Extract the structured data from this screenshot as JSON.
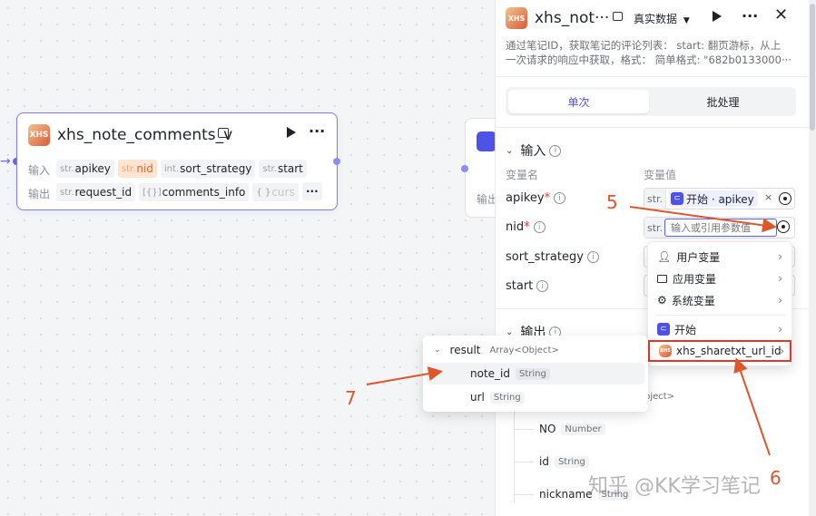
{
  "node": {
    "title": "xhs_note_comments_v",
    "input_label": "输入",
    "output_label": "输出",
    "inputs": [
      {
        "type": "str.",
        "name": "apikey",
        "highlight": false
      },
      {
        "type": "str.",
        "name": "nid",
        "highlight": true
      },
      {
        "type": "int.",
        "name": "sort_strategy",
        "highlight": false
      },
      {
        "type": "str.",
        "name": "start",
        "highlight": false
      }
    ],
    "outputs": [
      {
        "type": "str.",
        "name": "request_id"
      },
      {
        "type": "[{}]",
        "name": "comments_info"
      },
      {
        "type": "{ }",
        "name": "curs"
      }
    ],
    "more": "···",
    "icon_text": "XHS"
  },
  "ghost_node": {
    "output_label": "输出"
  },
  "panel": {
    "title": "xhs_not···",
    "env": "真实数据",
    "description_line1": "通过笔记ID，获取笔记的评论列表： start: 翻页游标，从上",
    "description_line2": "一次请求的响应中获取，格式：  简单格式: \"682b0133000···",
    "tabs": {
      "single": "单次",
      "batch": "批处理"
    },
    "input_section": "输入",
    "col_var_name": "变量名",
    "col_var_value": "变量值",
    "fields": [
      {
        "name": "apikey",
        "required": true
      },
      {
        "name": "nid",
        "required": true
      },
      {
        "name": "sort_strategy",
        "required": false
      },
      {
        "name": "start",
        "required": false
      }
    ],
    "apikey_ref": "开始 · apikey",
    "str_prefix": "str.",
    "nid_placeholder": "输入或引用参数值",
    "output_section": "输出",
    "output_tree": [
      {
        "name": "NO",
        "type": "Number"
      },
      {
        "name": "id",
        "type": "String"
      },
      {
        "name": "nickname",
        "type": "String"
      }
    ],
    "obj_tag": "bject>"
  },
  "menu": {
    "items": [
      {
        "label": "用户变量",
        "icon": "user-icon"
      },
      {
        "label": "应用变量",
        "icon": "folder-icon"
      },
      {
        "label": "系统变量",
        "icon": "gear-icon"
      }
    ],
    "start_label": "开始",
    "node_ref_label": "xhs_sharetxt_url_id"
  },
  "popover": {
    "root": {
      "name": "result",
      "type": "Array<Object>"
    },
    "children": [
      {
        "name": "note_id",
        "type": "String"
      },
      {
        "name": "url",
        "type": "String"
      }
    ]
  },
  "annotations": {
    "a5": "5",
    "a6": "6",
    "a7": "7"
  },
  "watermark": "知乎 @KK学习笔记",
  "colors": {
    "accent": "#4e52e6",
    "annotation": "#e0562b",
    "node_border": "#7f7cf0"
  }
}
